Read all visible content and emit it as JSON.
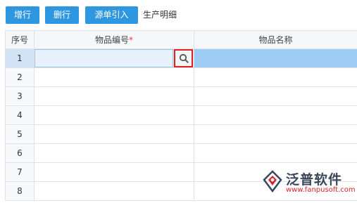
{
  "toolbar": {
    "add_row": "增行",
    "delete_row": "删行",
    "source_import": "源单引入",
    "title": "生产明细"
  },
  "table": {
    "columns": [
      "序号",
      "物品编号",
      "物品名称"
    ],
    "required_marker": "*",
    "rows": [
      {
        "index": "1"
      },
      {
        "index": "2"
      },
      {
        "index": "3"
      },
      {
        "index": "4"
      },
      {
        "index": "5"
      },
      {
        "index": "6"
      },
      {
        "index": "7"
      },
      {
        "index": "8"
      }
    ],
    "selected_row": "1"
  },
  "watermark": {
    "brand": "泛普软件",
    "url": "www.fanpusoft.com"
  },
  "colors": {
    "button_bg": "#2f97df",
    "selected_row": "#dbe9f7",
    "selected_name_cell": "#9ccbf3",
    "highlight_border": "#e02020",
    "required": "#e23b3b"
  }
}
